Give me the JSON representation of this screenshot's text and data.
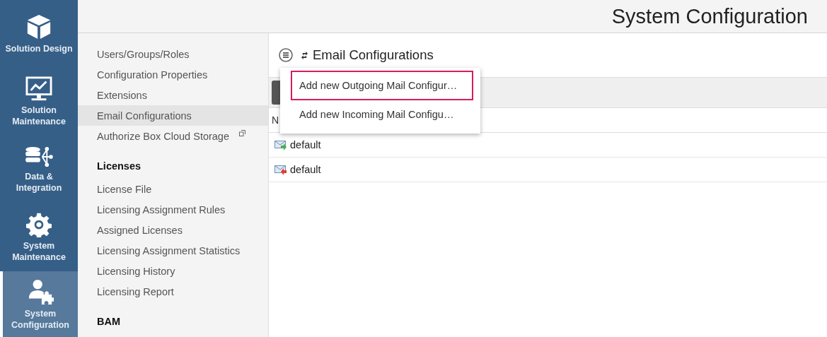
{
  "nav": [
    {
      "label": "Solution Design",
      "kind": "design",
      "selected": false
    },
    {
      "label": "Solution Maintenance",
      "kind": "maintenance",
      "selected": false
    },
    {
      "label": "Data & Integration",
      "kind": "data",
      "selected": false
    },
    {
      "label": "System Maintenance",
      "kind": "system",
      "selected": false
    },
    {
      "label": "System Configuration",
      "kind": "configuration",
      "selected": true
    }
  ],
  "header": {
    "title": "System Configuration"
  },
  "sidebar": {
    "sections": [
      {
        "items": [
          {
            "label": "Users/Groups/Roles",
            "selected": false,
            "external": false
          },
          {
            "label": "Configuration Properties",
            "selected": false,
            "external": false
          },
          {
            "label": "Extensions",
            "selected": false,
            "external": false
          },
          {
            "label": "Email Configurations",
            "selected": true,
            "external": false
          },
          {
            "label": "Authorize Box Cloud Storage",
            "selected": false,
            "external": true
          }
        ]
      },
      {
        "heading": "Licenses",
        "items": [
          {
            "label": "License File",
            "selected": false,
            "external": false
          },
          {
            "label": "Licensing Assignment Rules",
            "selected": false,
            "external": false
          },
          {
            "label": "Assigned Licenses",
            "selected": false,
            "external": false
          },
          {
            "label": "Licensing Assignment Statistics",
            "selected": false,
            "external": false
          },
          {
            "label": "Licensing History",
            "selected": false,
            "external": false
          },
          {
            "label": "Licensing Report",
            "selected": false,
            "external": false
          }
        ]
      },
      {
        "heading": "BAM"
      }
    ]
  },
  "panel": {
    "title": "Email Configurations",
    "menu": [
      {
        "label": "Add new Outgoing Mail Configur…",
        "selected": true
      },
      {
        "label": "Add new Incoming Mail Configu…",
        "selected": false
      }
    ],
    "table": {
      "columns": [
        "N"
      ],
      "rows": [
        {
          "name": "default",
          "kind": "outgoing"
        },
        {
          "name": "default",
          "kind": "incoming"
        }
      ]
    }
  }
}
